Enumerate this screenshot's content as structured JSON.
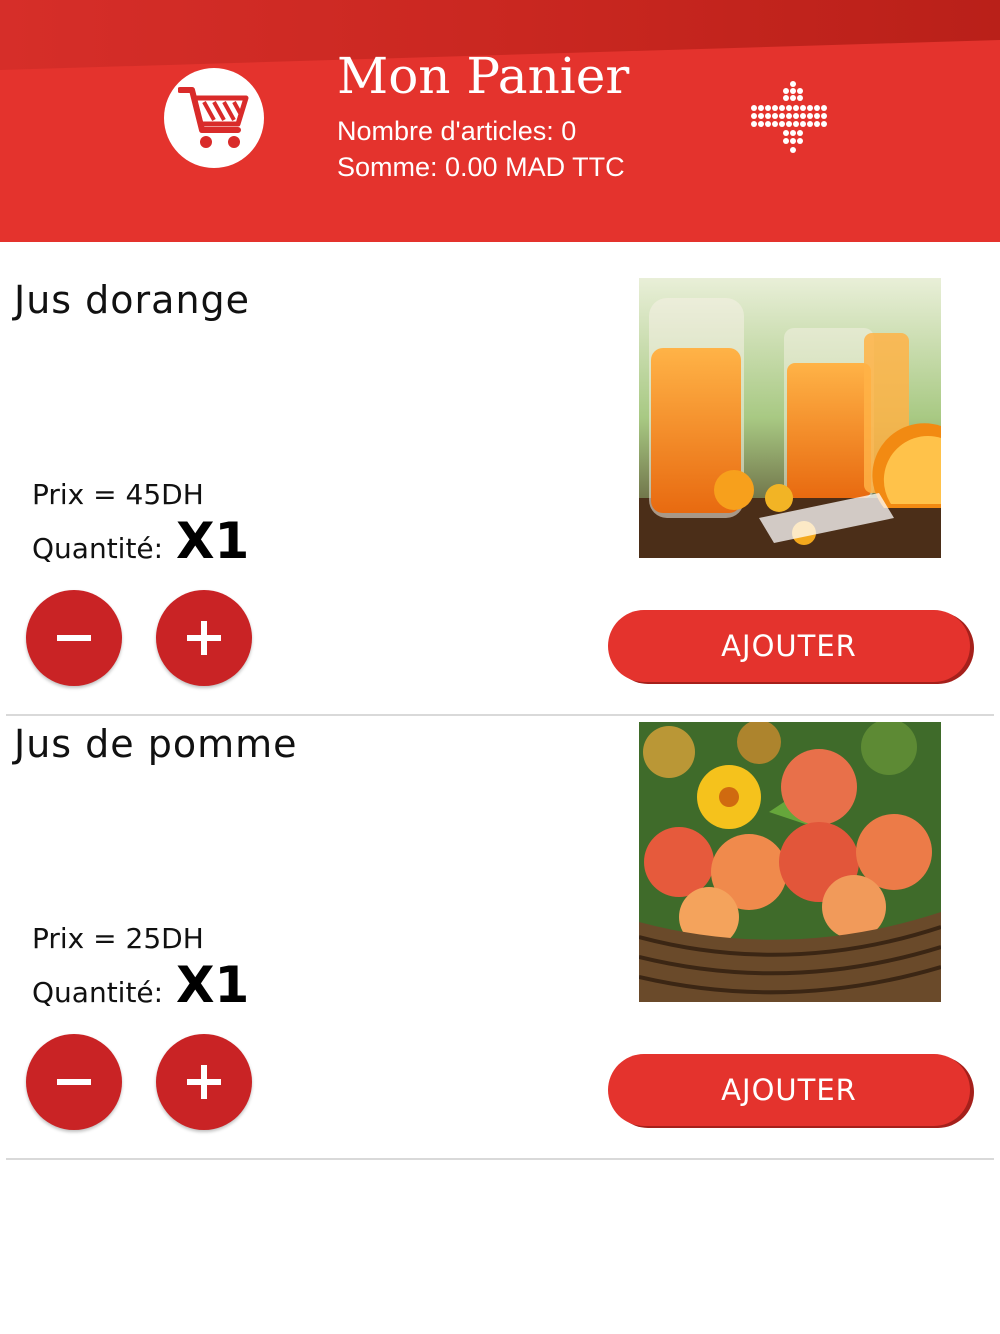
{
  "header": {
    "title": "Mon Panier",
    "count_line": "Nombre d'articles: 0",
    "total_line": "Somme: 0.00 MAD TTC",
    "cart_icon": "cart-icon",
    "arrow_icon": "arrow-down-dots-icon",
    "accent": "#e4332d"
  },
  "items": [
    {
      "name": "Jus dorange",
      "price": "Prix = 45DH",
      "qty_label": "Quantité:",
      "qty_value": "X1",
      "add_label": "AJOUTER",
      "image": "orange-juice-photo"
    },
    {
      "name": "Jus de pomme",
      "price": "Prix = 25DH",
      "qty_label": "Quantité:",
      "qty_value": "X1",
      "add_label": "AJOUTER",
      "image": "apple-basket-photo"
    }
  ]
}
